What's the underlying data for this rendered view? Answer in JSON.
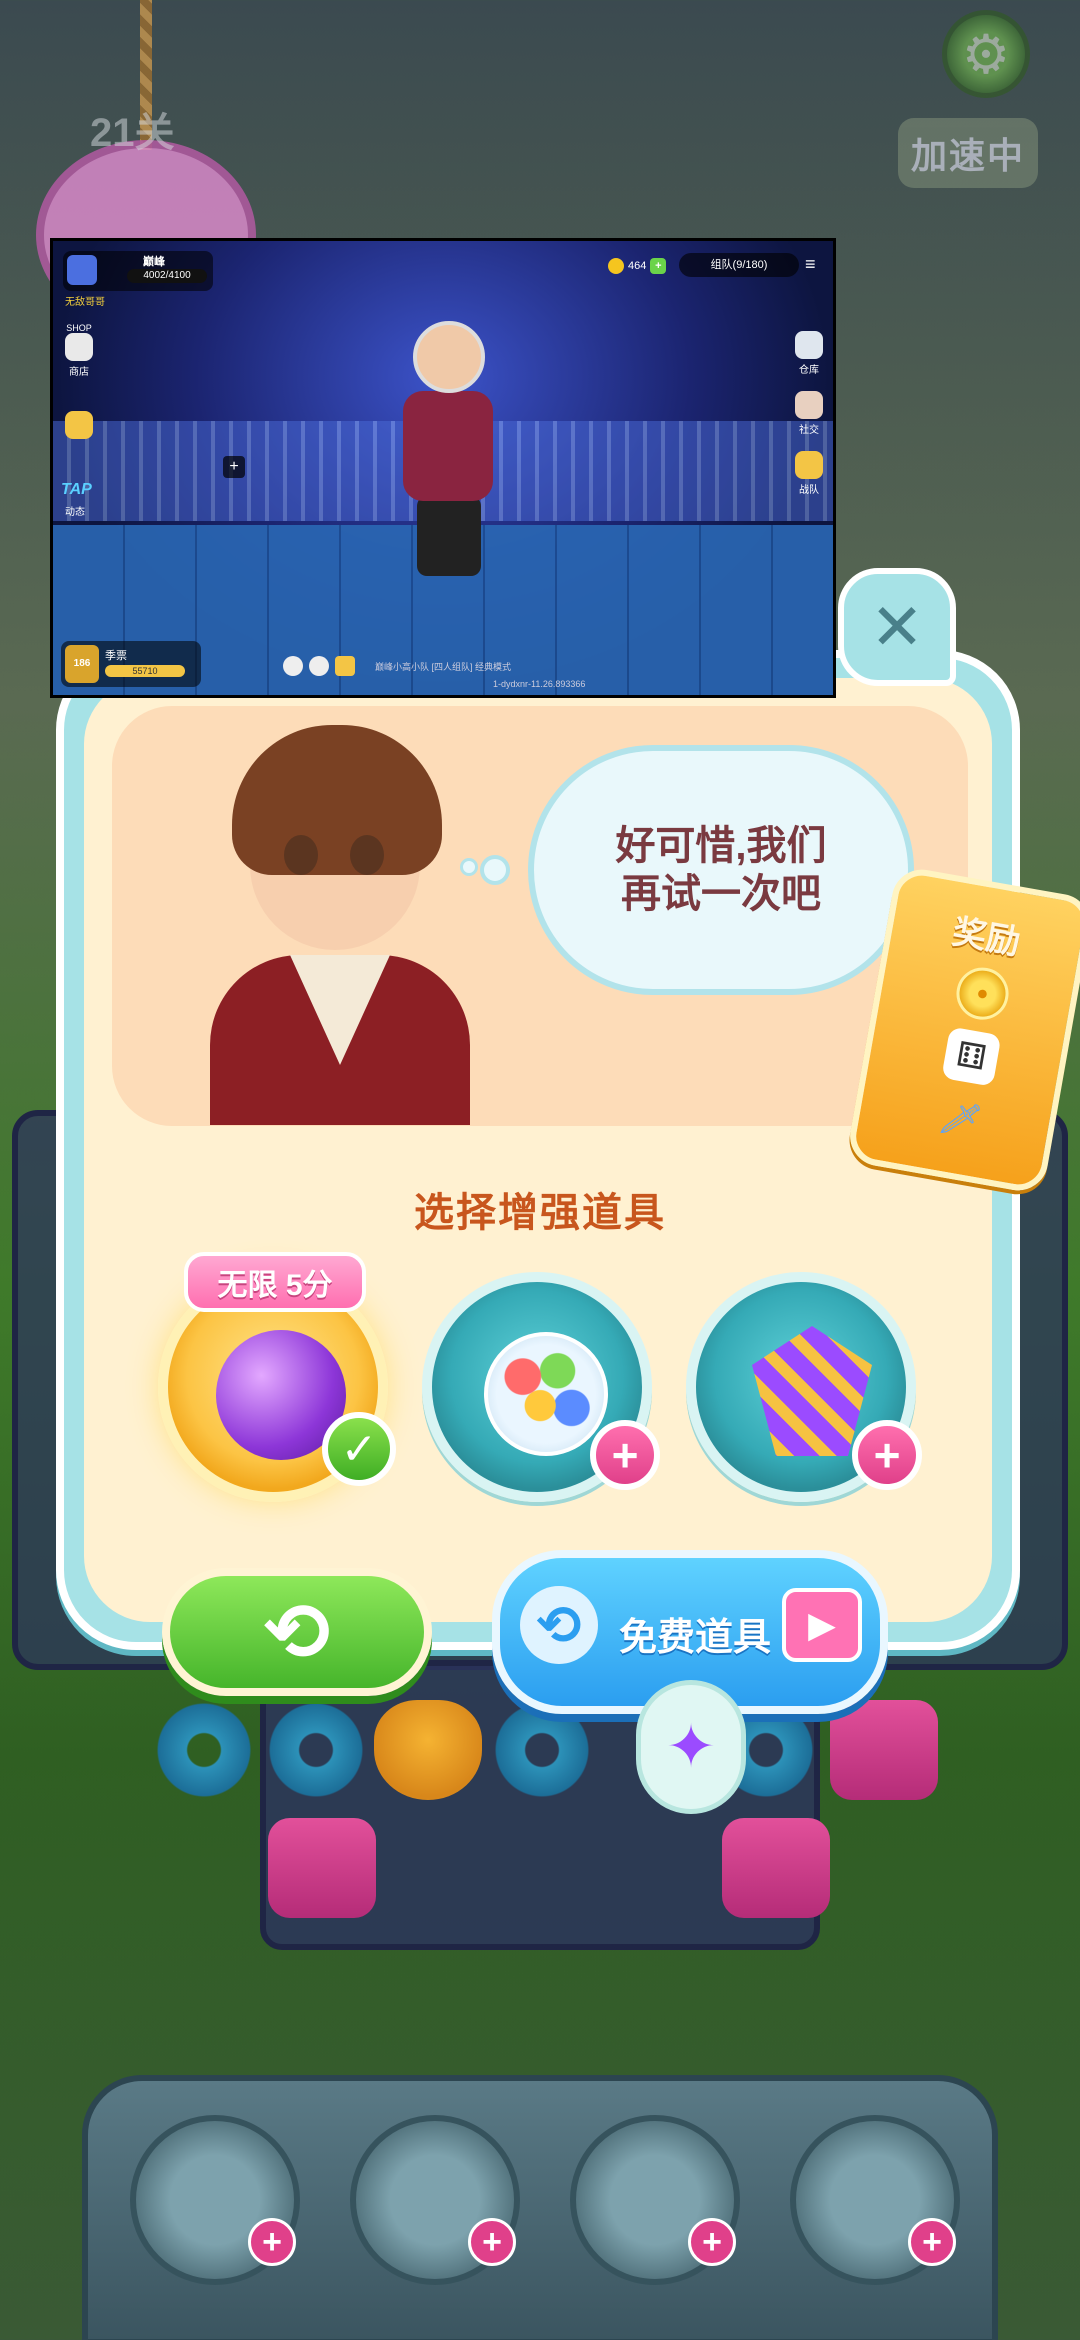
{
  "background": {
    "level_label": "21关",
    "speed_label": "加速中",
    "settings_icon": "gear-icon",
    "tools": [
      {
        "name": "spoon-tool",
        "icon": "spoon-icon"
      },
      {
        "name": "hammer-tool",
        "icon": "hammer-icon"
      },
      {
        "name": "glove-tool",
        "icon": "glove-icon"
      },
      {
        "name": "lollipop-tool",
        "icon": "lollipop-icon"
      }
    ]
  },
  "video_overlay": {
    "player_name": "巅峰",
    "hp": "4002/4100",
    "player_subtitle": "无敌哥哥",
    "coins": "464",
    "team": "组队(9/180)",
    "shop_label": "商店",
    "shop_top": "SHOP",
    "tap_label": "TAP",
    "moments_label": "动态",
    "warehouse_label": "仓库",
    "social_label": "社交",
    "team_label": "战队",
    "rank_label": "季票",
    "rank_level": "186",
    "rank_points": "55710",
    "chat_text": "巅峰小高小队 [四人组队] 经典模式",
    "version": "1-dydxnr-11.26.893366"
  },
  "dialog": {
    "speech": [
      "好可惜,我们",
      "再试一次吧"
    ],
    "reward_title": "奖励",
    "rewards": [
      "coin-icon",
      "dice-icon",
      "sword-icon"
    ],
    "choose_title": "选择增强道具",
    "boosts": [
      {
        "name": "bomb-potion",
        "selected": true,
        "badge": "无限 5分"
      },
      {
        "name": "gumball-machine",
        "selected": false
      },
      {
        "name": "rocket-firework",
        "selected": false
      }
    ],
    "retry_icon": "⟲",
    "free_label": "免费道具",
    "free_icon": "⟲",
    "video_icon": "▶",
    "close_icon": "✕",
    "check_icon": "✓",
    "plus_icon": "+"
  },
  "colors": {
    "dialog_bg": "#fff1d1",
    "dialog_border": "#a6e2e6",
    "title": "#c8561d",
    "retry_green": "#46b52b",
    "free_blue": "#2b9ef0",
    "reward_orange": "#f6a11b"
  }
}
